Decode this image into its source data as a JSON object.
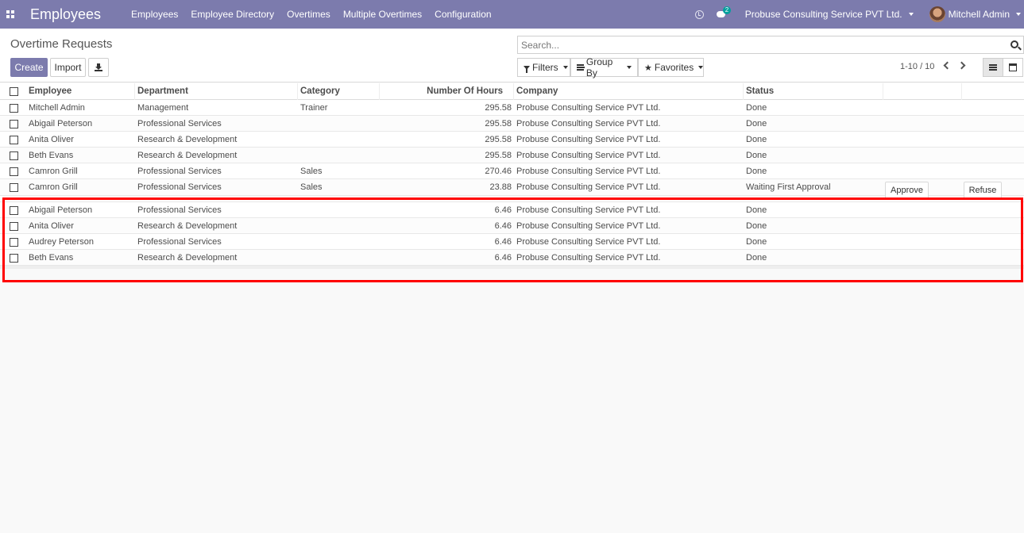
{
  "navbar": {
    "app_title": "Employees",
    "menu": [
      "Employees",
      "Employee Directory",
      "Overtimes",
      "Multiple Overtimes",
      "Configuration"
    ],
    "chat_badge": "2",
    "company": "Probuse Consulting Service PVT Ltd.",
    "user": "Mitchell Admin",
    "colors": {
      "navbar_bg": "#7c7bad",
      "badge_bg": "#00a09d"
    }
  },
  "control_panel": {
    "title": "Overtime Requests",
    "create_label": "Create",
    "import_label": "Import",
    "search_placeholder": "Search...",
    "filters_label": "Filters",
    "groupby_label": "Group By",
    "favorites_label": "Favorites",
    "pager": "1-10 / 10"
  },
  "table": {
    "headers": {
      "employee": "Employee",
      "department": "Department",
      "category": "Category",
      "hours": "Number Of Hours",
      "company": "Company",
      "status": "Status"
    },
    "rows": [
      {
        "employee": "Mitchell Admin",
        "department": "Management",
        "category": "Trainer",
        "hours": "295.58",
        "company": "Probuse Consulting Service PVT Ltd.",
        "status": "Done"
      },
      {
        "employee": "Abigail Peterson",
        "department": "Professional Services",
        "category": "",
        "hours": "295.58",
        "company": "Probuse Consulting Service PVT Ltd.",
        "status": "Done"
      },
      {
        "employee": "Anita Oliver",
        "department": "Research & Development",
        "category": "",
        "hours": "295.58",
        "company": "Probuse Consulting Service PVT Ltd.",
        "status": "Done"
      },
      {
        "employee": "Beth Evans",
        "department": "Research & Development",
        "category": "",
        "hours": "295.58",
        "company": "Probuse Consulting Service PVT Ltd.",
        "status": "Done"
      },
      {
        "employee": "Camron Grill",
        "department": "Professional Services",
        "category": "Sales",
        "hours": "270.46",
        "company": "Probuse Consulting Service PVT Ltd.",
        "status": "Done"
      },
      {
        "employee": "Camron Grill",
        "department": "Professional Services",
        "category": "Sales",
        "hours": "23.88",
        "company": "Probuse Consulting Service PVT Ltd.",
        "status": "Waiting First Approval",
        "approve": "Approve",
        "refuse": "Refuse"
      },
      {
        "employee": "Abigail Peterson",
        "department": "Professional Services",
        "category": "",
        "hours": "6.46",
        "company": "Probuse Consulting Service PVT Ltd.",
        "status": "Done"
      },
      {
        "employee": "Anita Oliver",
        "department": "Research & Development",
        "category": "",
        "hours": "6.46",
        "company": "Probuse Consulting Service PVT Ltd.",
        "status": "Done"
      },
      {
        "employee": "Audrey Peterson",
        "department": "Professional Services",
        "category": "",
        "hours": "6.46",
        "company": "Probuse Consulting Service PVT Ltd.",
        "status": "Done"
      },
      {
        "employee": "Beth Evans",
        "department": "Research & Development",
        "category": "",
        "hours": "6.46",
        "company": "Probuse Consulting Service PVT Ltd.",
        "status": "Done"
      }
    ]
  },
  "highlight_color": "#ff0000"
}
